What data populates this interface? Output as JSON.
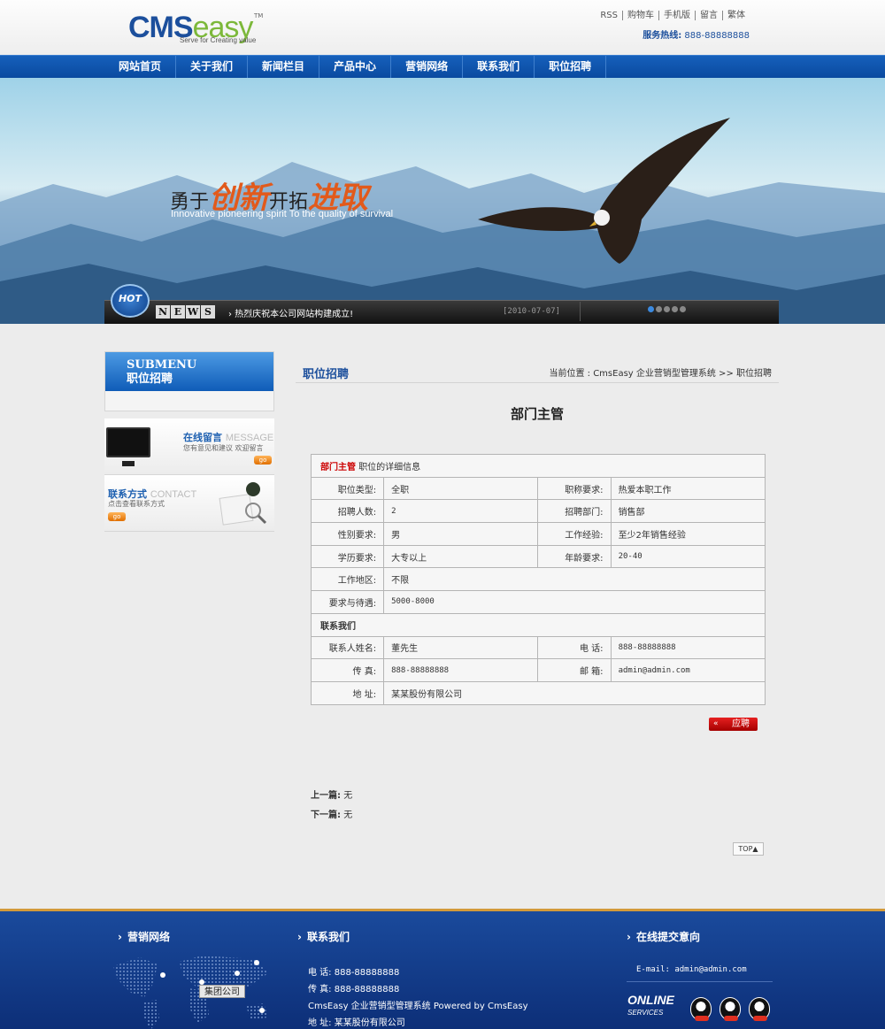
{
  "header": {
    "logo_cms": "CMS",
    "logo_easy": "easy",
    "logo_tm": "TM",
    "logo_slogan": "Serve for Creating value",
    "toplinks": [
      "RSS",
      "购物车",
      "手机版",
      "留言",
      "繁体"
    ],
    "hotline_label": "服务热线:",
    "hotline_number": "888-88888888"
  },
  "nav": {
    "items": [
      "网站首页",
      "关于我们",
      "新闻栏目",
      "产品中心",
      "营销网络",
      "联系我们",
      "职位招聘"
    ]
  },
  "banner": {
    "slogan_1": "勇于",
    "slogan_2": "创新",
    "slogan_3": "开拓",
    "slogan_4": "进取",
    "slogan_en": "Innovative pioneering spirit To the quality of survival",
    "hot_badge": "HOT",
    "news_letters": [
      "N",
      "E",
      "W",
      "S"
    ],
    "news_text": "› 热烈庆祝本公司网站构建成立!",
    "news_date": "[2010-07-07]"
  },
  "sidebar": {
    "submenu_en": "SUBMENU",
    "submenu_cn": "职位招聘",
    "message_title": "在线留言",
    "message_en": "MESSAGE",
    "message_sub": "您有意见和建议 欢迎留言",
    "contact_title": "联系方式",
    "contact_en": "CONTACT",
    "contact_sub": "点击查看联系方式",
    "go_label": "go"
  },
  "main": {
    "title": "职位招聘",
    "breadcrumb": "当前位置 : CmsEasy 企业营销型管理系统  >> 职位招聘",
    "job_title": "部门主管",
    "table_head_red": "部门主管",
    "table_head_rest": "职位的详细信息",
    "rows": {
      "job_type_k": "职位类型:",
      "job_type_v": "全职",
      "title_req_k": "职称要求:",
      "title_req_v": "热爱本职工作",
      "count_k": "招聘人数:",
      "count_v": "2",
      "dept_k": "招聘部门:",
      "dept_v": "销售部",
      "gender_k": "性别要求:",
      "gender_v": "男",
      "exp_k": "工作经验:",
      "exp_v": "至少2年销售经验",
      "edu_k": "学历要求:",
      "edu_v": "大专以上",
      "age_k": "年龄要求:",
      "age_v": "20-40",
      "area_k": "工作地区:",
      "area_v": "不限",
      "salary_k": "要求与待遇:",
      "salary_v": "5000-8000",
      "contact_head": "联系我们",
      "person_k": "联系人姓名:",
      "person_v": "董先生",
      "phone_k": "电  话:",
      "phone_v": "888-88888888",
      "fax_k": "传  真:",
      "fax_v": "888-88888888",
      "email_k": "邮  箱:",
      "email_v": "admin@admin.com",
      "addr_k": "地  址:",
      "addr_v": "某某股份有限公司"
    },
    "apply_arrow": "«",
    "apply_label": "应聘",
    "prev_label": "上一篇:",
    "prev_value": "无",
    "next_label": "下一篇:",
    "next_value": "无",
    "top_label": "TOP▲"
  },
  "footer": {
    "network_title": "营销网络",
    "contact_title": "联系我们",
    "intent_title": "在线提交意向",
    "group_label": "集团公司",
    "phone": "电 话: 888-88888888",
    "fax": "传 真: 888-88888888",
    "powered": "CmsEasy 企业营销型管理系统 Powered by CmsEasy",
    "address": "地 址: 某某股份有限公司",
    "email": "E-mail: admin@admin.com",
    "online": "ONLINE",
    "online_sub": "SERVICES"
  }
}
